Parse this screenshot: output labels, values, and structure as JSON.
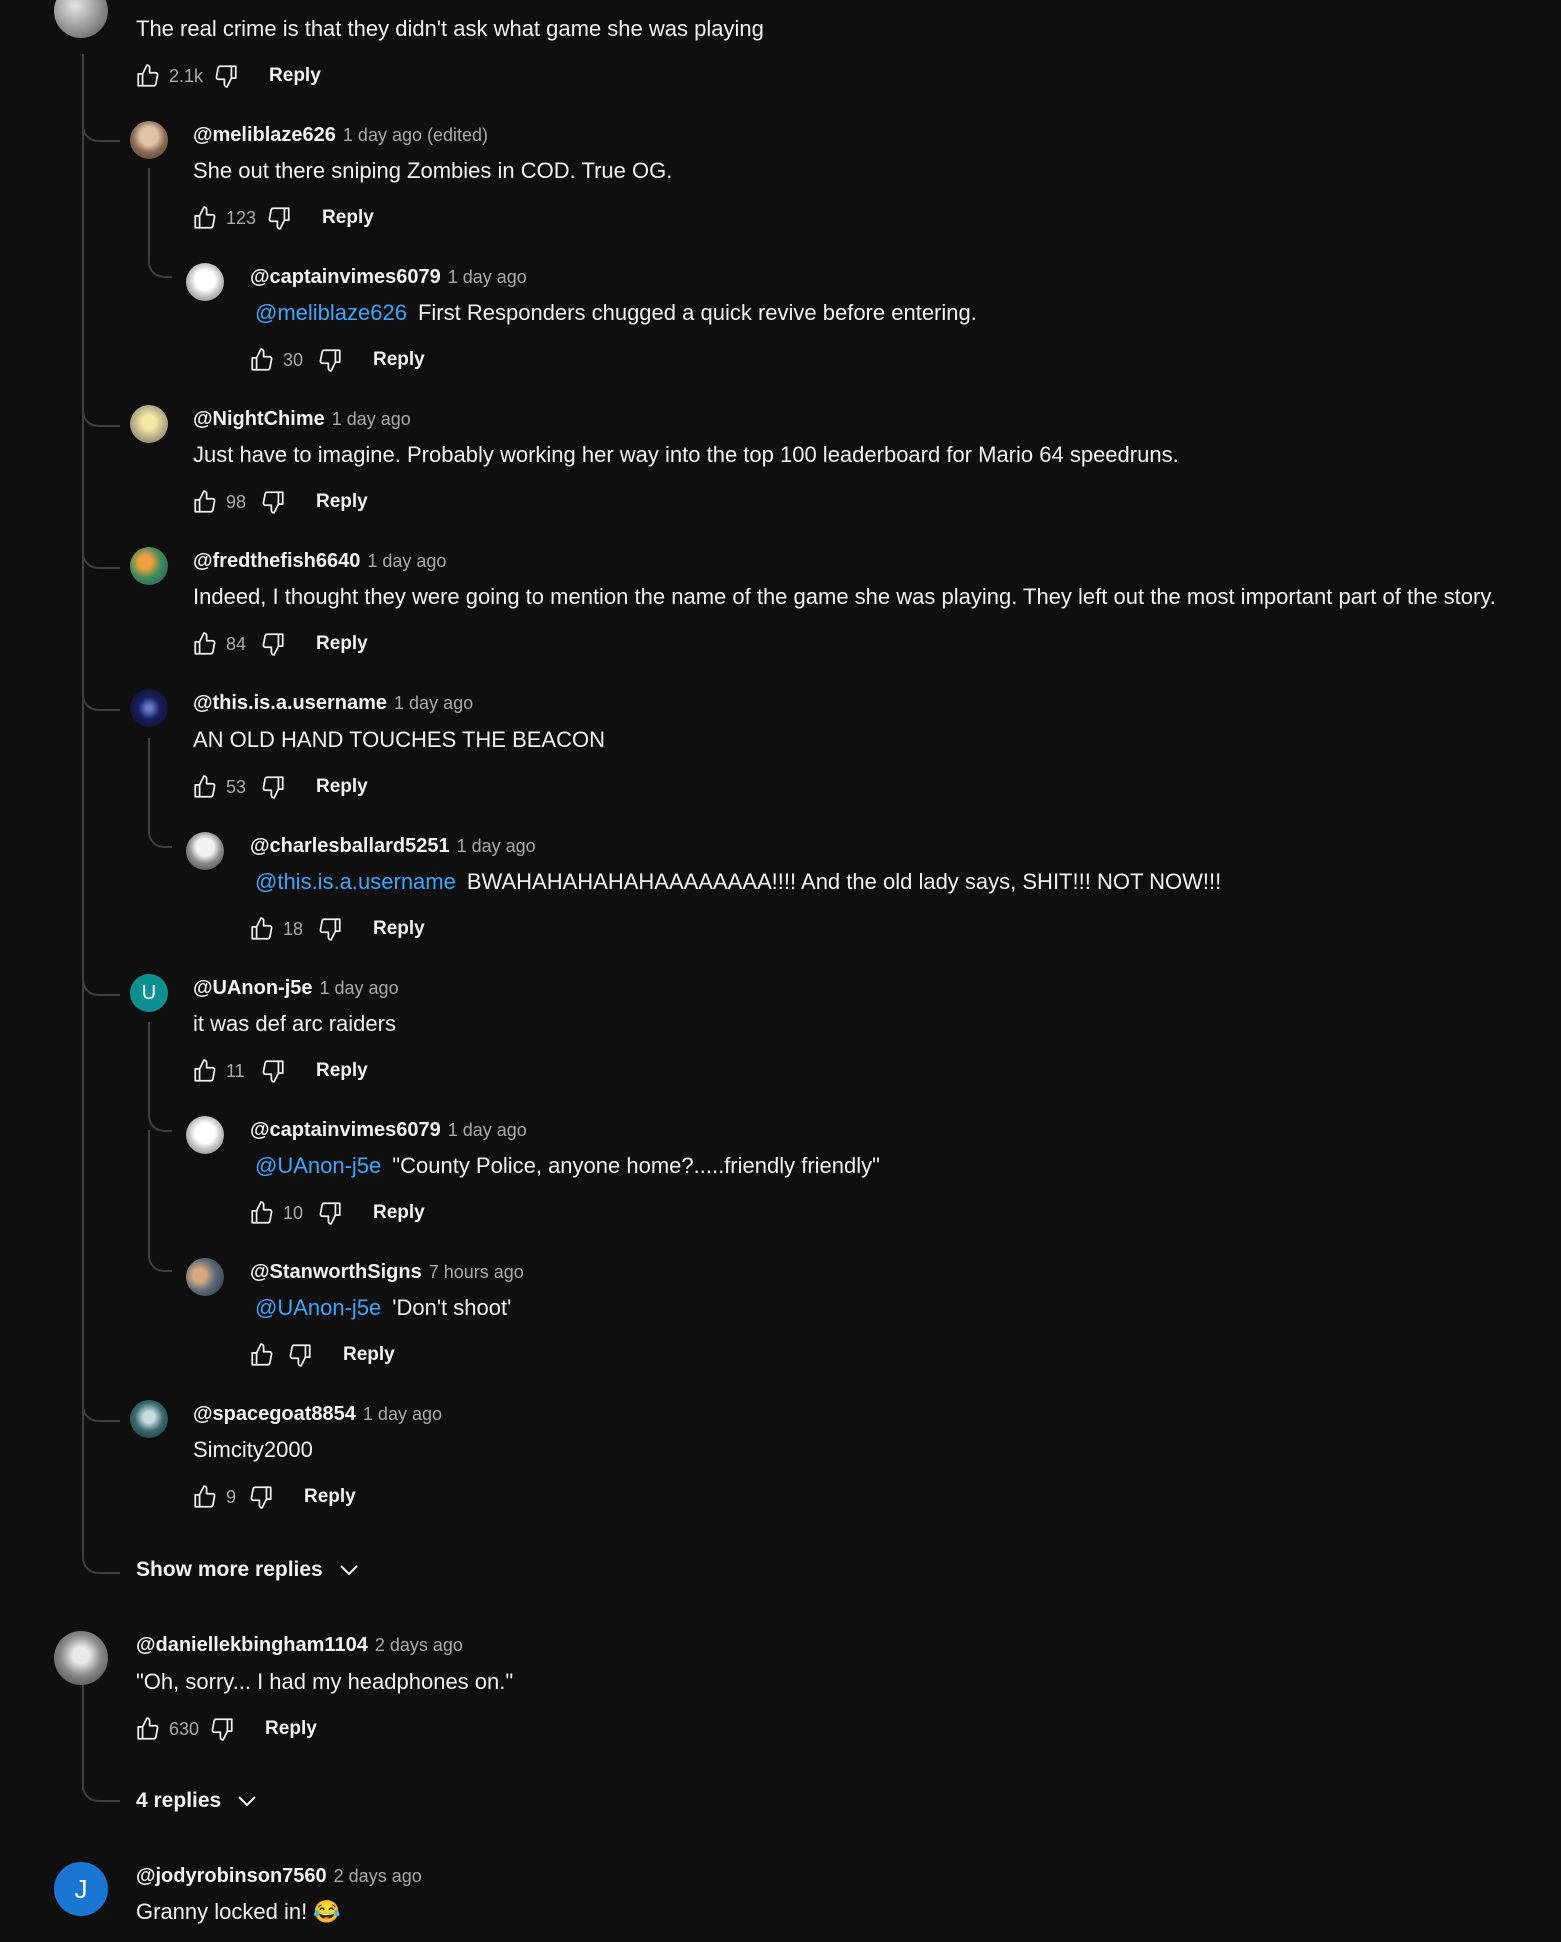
{
  "c0": {
    "text": "The real crime is that they didn't  ask what game she was playing",
    "likes": "2.1k",
    "reply": "Reply"
  },
  "c1": {
    "author": "@meliblaze626",
    "time": "1 day ago (edited)",
    "text": "She out there sniping Zombies in COD. True OG.",
    "likes": "123",
    "reply": "Reply"
  },
  "c2": {
    "author": "@captainvimes6079",
    "time": "1 day ago",
    "mention": "@meliblaze626",
    "text": "First Responders chugged a quick revive before entering.",
    "likes": "30",
    "reply": "Reply"
  },
  "c3": {
    "author": "@NightChime",
    "time": "1 day ago",
    "text": "Just have to imagine.  Probably working her way into the top 100 leaderboard for Mario 64 speedruns.",
    "likes": "98",
    "reply": "Reply"
  },
  "c4": {
    "author": "@fredthefish6640",
    "time": "1 day ago",
    "text": "Indeed, I thought they were going to mention the name of the game she was playing. They left out the most important part of the story.",
    "likes": "84",
    "reply": "Reply"
  },
  "c5": {
    "author": "@this.is.a.username",
    "time": "1 day ago",
    "text": "AN OLD HAND TOUCHES THE BEACON",
    "likes": "53",
    "reply": "Reply"
  },
  "c6": {
    "author": "@charlesballard5251",
    "time": "1 day ago",
    "mention": "@this.is.a.username",
    "text": "BWAHAHAHAHAHAAAAAAAA!!!!  And the old lady says, SHIT!!!  NOT NOW!!!",
    "likes": "18",
    "reply": "Reply"
  },
  "c7": {
    "author": "@UAnon-j5e",
    "time": "1 day ago",
    "text": "it was def arc raiders",
    "likes": "11",
    "reply": "Reply",
    "avatar_letter": "U",
    "avatar_color": "#0b8f8f"
  },
  "c8": {
    "author": "@captainvimes6079",
    "time": "1 day ago",
    "mention": "@UAnon-j5e",
    "text": "\"County Police, anyone home?.....friendly friendly\"",
    "likes": "10",
    "reply": "Reply"
  },
  "c9": {
    "author": "@StanworthSigns",
    "time": "7 hours ago",
    "mention": "@UAnon-j5e",
    "text": "'Don't shoot'",
    "likes": "",
    "reply": "Reply"
  },
  "c10": {
    "author": "@spacegoat8854",
    "time": "1 day ago",
    "text": "Simcity2000",
    "likes": "9",
    "reply": "Reply"
  },
  "show_more": "Show more replies",
  "c11": {
    "author": "@daniellekbingham1104",
    "time": "2 days ago",
    "text": "\"Oh, sorry... I had my headphones on.\"",
    "likes": "630",
    "reply": "Reply"
  },
  "replies_toggle": "4 replies",
  "c12": {
    "author": "@jodyrobinson7560",
    "time": "2 days ago",
    "text": "Granny locked in!",
    "emoji": "😂",
    "avatar_letter": "J",
    "avatar_color": "#1976d2"
  },
  "colors": {
    "background": "#0f0f0f",
    "text": "#f1f1f1",
    "secondary": "#aaaaaa",
    "mention": "#3ea6ff"
  }
}
